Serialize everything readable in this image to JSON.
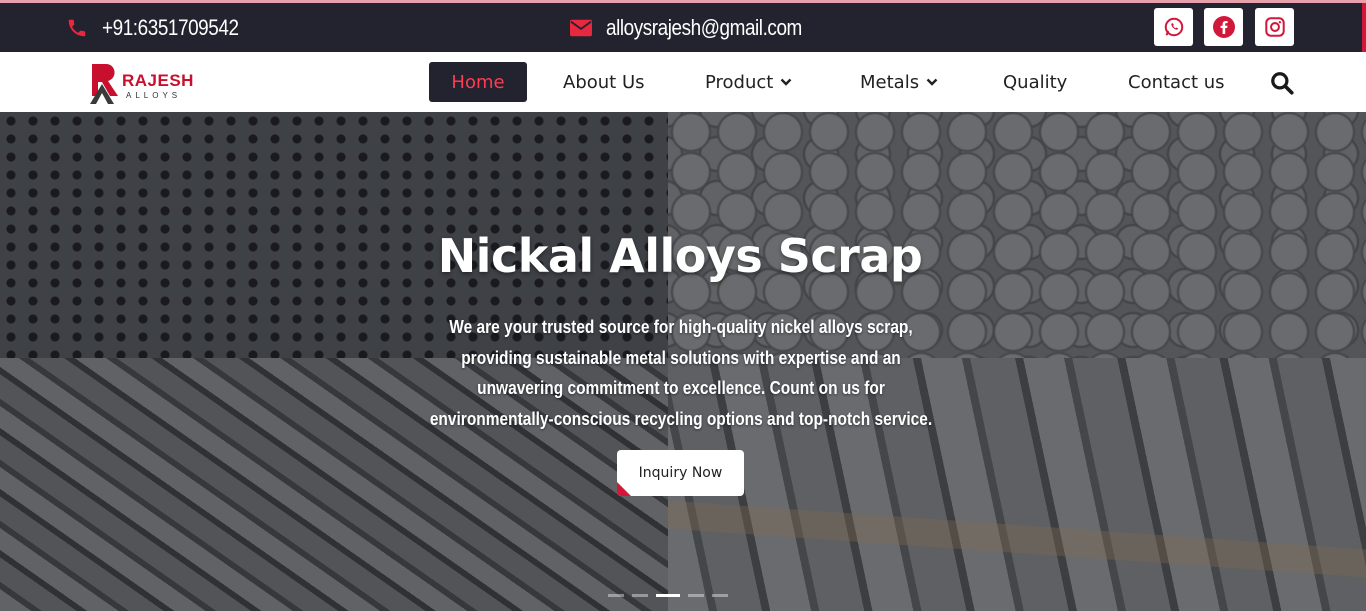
{
  "topbar": {
    "phone": "+91:6351709542",
    "email": "alloysrajesh@gmail.com",
    "social": [
      "whatsapp-icon",
      "facebook-icon",
      "instagram-icon"
    ]
  },
  "logo": {
    "name": "RAJESH",
    "sub": "ALLOYS"
  },
  "nav": {
    "home": "Home",
    "about": "About Us",
    "product": "Product",
    "metals": "Metals",
    "quality": "Quality",
    "contact": "Contact us"
  },
  "hero": {
    "title": "Nickal Alloys Scrap",
    "text": "We are your trusted source for high-quality nickel alloys scrap, providing sustainable metal solutions with expertise and an unwavering commitment to excellence. Count on us for environmentally-conscious recycling options and top-notch service.",
    "cta": "Inquiry Now",
    "active_slide": 3,
    "slide_count": 5
  },
  "colors": {
    "accent": "#d2183a",
    "topbar_bg": "#23232f",
    "home_text": "#ff3b52"
  }
}
